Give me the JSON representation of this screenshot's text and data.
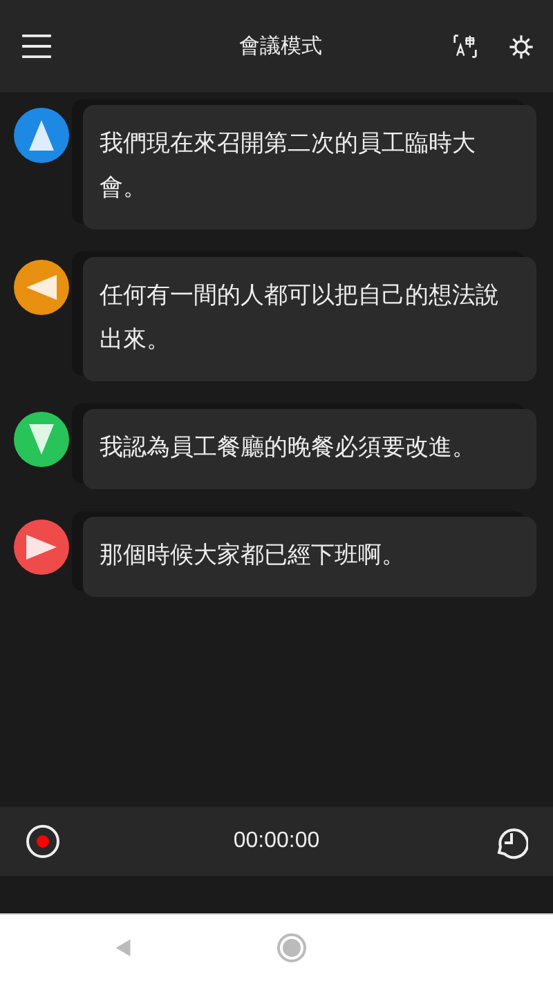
{
  "header": {
    "title": "會議模式"
  },
  "messages": [
    {
      "text": "我們現在來召開第二次的員工臨時大會。",
      "color": "#1e88e5",
      "kind": "up"
    },
    {
      "text": "任何有一間的人都可以把自己的想法說出來。",
      "color": "#e8900f",
      "kind": "left"
    },
    {
      "text": "我認為員工餐廳的晚餐必須要改進。",
      "color": "#28c45a",
      "kind": "down"
    },
    {
      "text": "那個時候大家都已經下班啊。",
      "color": "#ef4b4b",
      "kind": "right"
    }
  ],
  "footer": {
    "timer": "00:00:00"
  }
}
